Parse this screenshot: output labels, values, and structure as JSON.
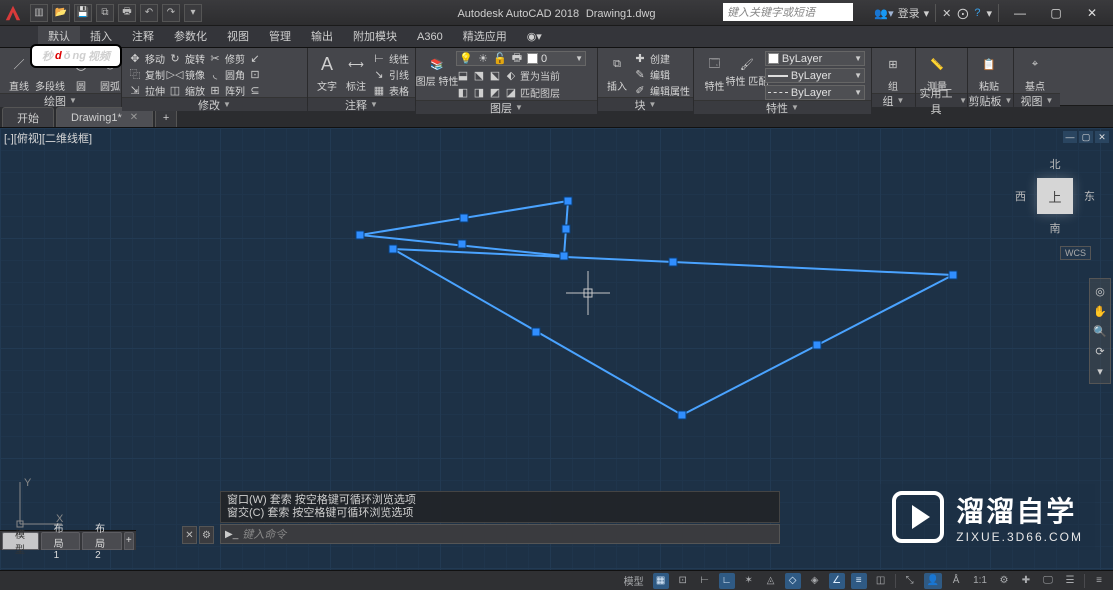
{
  "title": {
    "app": "Autodesk AutoCAD 2018",
    "file": "Drawing1.dwg",
    "search_placeholder": "键入关键字或短语",
    "login": "登录"
  },
  "menu": {
    "items": [
      "默认",
      "插入",
      "注释",
      "参数化",
      "视图",
      "管理",
      "输出",
      "附加模块",
      "A360",
      "精选应用"
    ]
  },
  "ribbon": {
    "draw": {
      "title": "绘图",
      "line": "直线",
      "polyline": "多段线",
      "circle": "圆",
      "arc": "圆弧"
    },
    "modify": {
      "title": "修改",
      "move": "移动",
      "rotate": "旋转",
      "trim": "修剪",
      "copy": "复制",
      "mirror": "镜像",
      "fillet": "圆角",
      "stretch": "拉伸",
      "scale": "缩放",
      "array": "阵列"
    },
    "annot": {
      "title": "注释",
      "text": "文字",
      "dim": "标注",
      "leader": "引线",
      "linear": "线性",
      "table": "表格"
    },
    "layer": {
      "title": "图层",
      "props": "图层\n特性",
      "setcur": "置为当前",
      "match": "匹配图层",
      "current": "0"
    },
    "block": {
      "title": "块",
      "insert": "插入",
      "create": "创建",
      "edit": "编辑",
      "editattr": "编辑属性"
    },
    "props": {
      "title": "特性",
      "propsbtn": "特性",
      "match": "特性\n匹配",
      "bylayer": "ByLayer"
    },
    "group": {
      "title": "组",
      "btn": "组"
    },
    "util": {
      "title": "实用工具",
      "measure": "测量"
    },
    "clip": {
      "title": "剪贴板",
      "paste": "粘贴"
    },
    "view": {
      "title": "视图",
      "base": "基点"
    }
  },
  "tabs": {
    "start": "开始",
    "drawing": "Drawing1*"
  },
  "viewport": {
    "label": "[-][俯视][二维线框]"
  },
  "viewcube": {
    "face": "上",
    "n": "北",
    "s": "南",
    "w": "西",
    "e": "东",
    "wcs": "WCS"
  },
  "ucs": {
    "x": "X",
    "y": "Y"
  },
  "cmd": {
    "hist1": "窗口(W) 套索  按空格键可循环浏览选项",
    "hist2": "窗交(C) 套索  按空格键可循环浏览选项",
    "prompt": "键入命令"
  },
  "layouts": {
    "model": "模型",
    "l1": "布局1",
    "l2": "布局2"
  },
  "status": {
    "model": "模型",
    "scale": "1:1"
  },
  "overlay": {
    "logo_a": "秒",
    "logo_b": "d",
    "logo_c": "ng",
    "logo_d": "视频",
    "wm1": "溜溜自学",
    "wm2": "ZIXUE.3D66.COM"
  }
}
